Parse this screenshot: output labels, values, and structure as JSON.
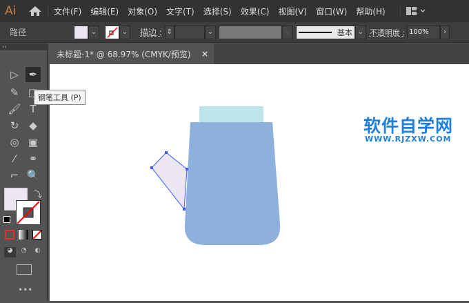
{
  "app": {
    "logo": "Ai"
  },
  "menu": [
    "文件(F)",
    "编辑(E)",
    "对象(O)",
    "文字(T)",
    "选择(S)",
    "效果(C)",
    "视图(V)",
    "窗口(W)",
    "帮助(H)"
  ],
  "control": {
    "object_type": "路径",
    "stroke_label": "描边 :",
    "brush_label": "基本",
    "opacity_label": "不透明度 :",
    "opacity_value": "100%"
  },
  "tab": {
    "title": "未标题-1* @ 68.97% (CMYK/预览)",
    "close": "×"
  },
  "tooltip": "钢笔工具 (P)",
  "watermark": {
    "title": "软件自学网",
    "url": "WWW.RJZXW.COM"
  },
  "colors": {
    "fill": "#ebe6f1",
    "body": "#8eb0dc",
    "lid": "#bfe3ea",
    "path": "#3a5cf5",
    "watermark": "#1e7fd8"
  }
}
